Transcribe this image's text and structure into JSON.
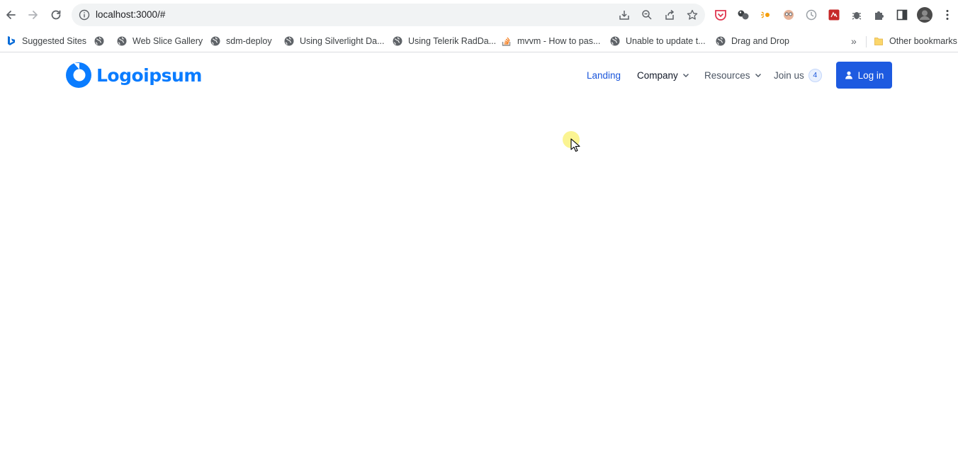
{
  "browser": {
    "url_host": "localhost:3000/#",
    "url_path": "",
    "bookmarks": [
      {
        "label": "Suggested Sites",
        "icon": "bing-icon"
      },
      {
        "label": "",
        "icon": "globe-icon"
      },
      {
        "label": "Web Slice Gallery",
        "icon": "globe-icon"
      },
      {
        "label": "sdm-deploy",
        "icon": "globe-icon"
      },
      {
        "label": "Using Silverlight Da...",
        "icon": "globe-icon"
      },
      {
        "label": "Using Telerik RadDa...",
        "icon": "globe-icon"
      },
      {
        "label": "mvvm - How to pas...",
        "icon": "stackoverflow-icon"
      },
      {
        "label": "Unable to update t...",
        "icon": "globe-icon"
      },
      {
        "label": "Drag and Drop",
        "icon": "globe-icon"
      }
    ],
    "overflow": "»",
    "other_bookmarks": "Other bookmarks"
  },
  "site": {
    "logo_text": "Logoipsum",
    "nav": {
      "landing": "Landing",
      "company": "Company",
      "resources": "Resources",
      "join_us": "Join us",
      "join_us_count": "4"
    },
    "login_label": "Log in"
  },
  "colors": {
    "brand": "#0a7cff",
    "primary_button": "#1d5ae0",
    "active_link": "#1a56db"
  }
}
